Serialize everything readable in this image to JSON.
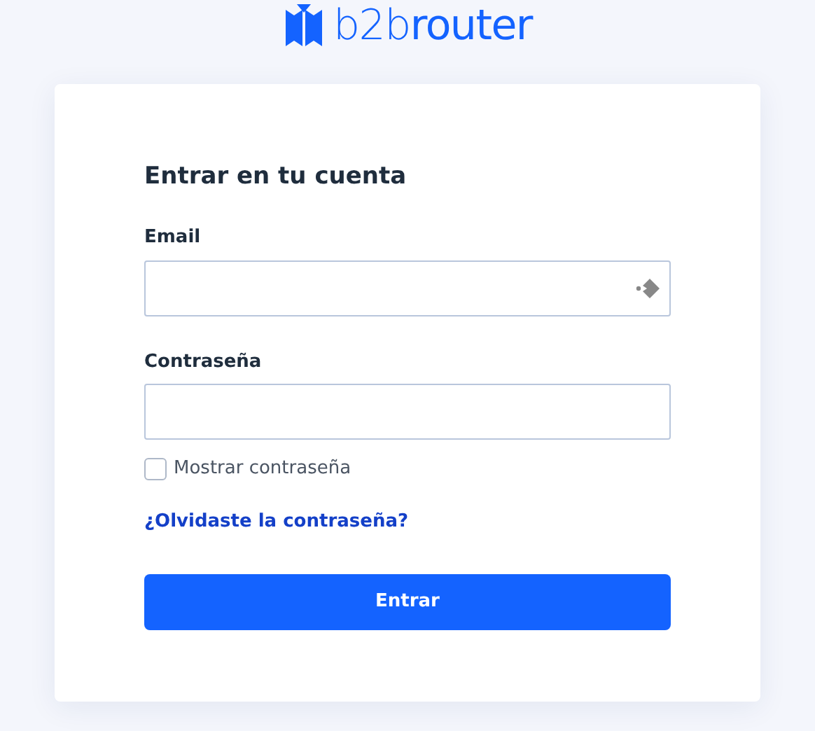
{
  "logo": {
    "text": "b2b**router**"
  },
  "form": {
    "title": "Entrar en tu cuenta",
    "fields": [
      {
        "label": "Email",
        "autofill_icon": true
      },
      {
        "label": "Contraseña",
        "autofill_icon": false
      }
    ],
    "show_password": {
      "label": "Mostrar contraseña",
      "checked": false
    },
    "forgot_link": "¿Olvidaste la contraseña?",
    "submit": "Entrar"
  }
}
